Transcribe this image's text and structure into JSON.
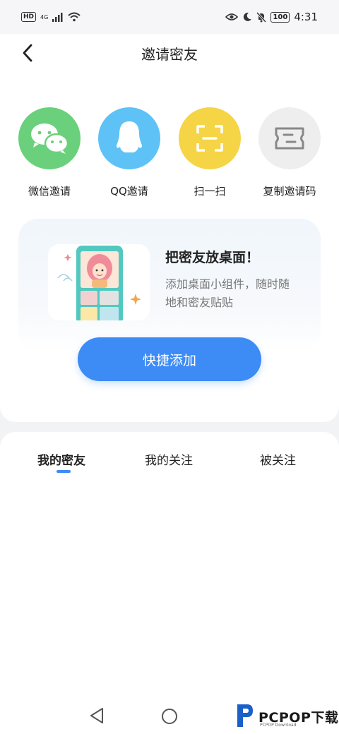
{
  "status_bar": {
    "network_type": "4G",
    "battery": "100",
    "time": "4:31"
  },
  "header": {
    "title": "邀请密友"
  },
  "actions": [
    {
      "label": "微信邀请",
      "icon": "wechat-icon",
      "color": "#6ad07b"
    },
    {
      "label": "QQ邀请",
      "icon": "qq-icon",
      "color": "#5ec2f7"
    },
    {
      "label": "扫一扫",
      "icon": "scan-icon",
      "color": "#f5d446"
    },
    {
      "label": "复制邀请码",
      "icon": "ticket-icon",
      "color": "#eeeeee"
    }
  ],
  "widget_promo": {
    "title": "把密友放桌面！",
    "description": "添加桌面小组件，随时随地和密友贴贴",
    "button_label": "快捷添加"
  },
  "tabs": [
    {
      "label": "我的密友",
      "active": true
    },
    {
      "label": "我的关注",
      "active": false
    },
    {
      "label": "被关注",
      "active": false
    }
  ],
  "watermark": {
    "brand": "PCPOP下载",
    "sub": "PCPOP Download"
  },
  "colors": {
    "accent": "#3d8bf5",
    "wechat_green": "#6ad07b",
    "qq_blue": "#5ec2f7",
    "scan_yellow": "#f5d446"
  }
}
